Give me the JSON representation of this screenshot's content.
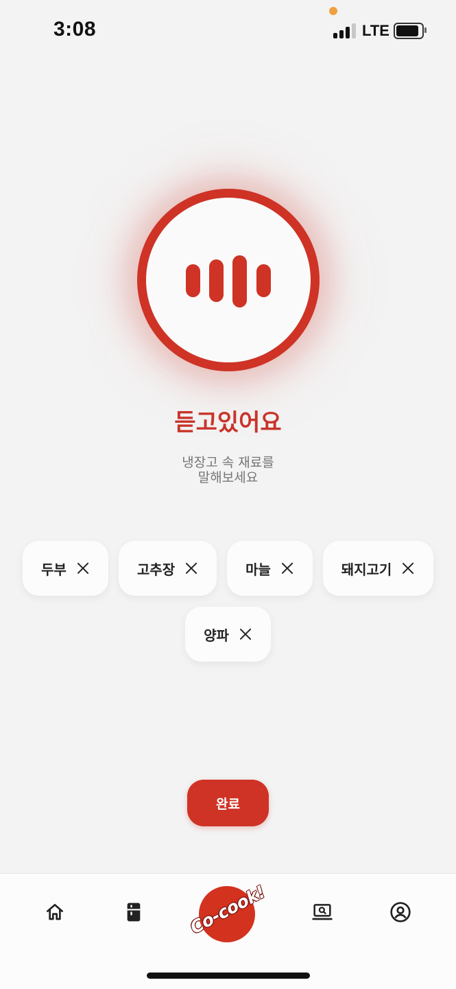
{
  "status_bar": {
    "time": "3:08",
    "network": "LTE"
  },
  "voice": {
    "title": "듣고있어요",
    "prompt_line1": "냉장고 속 재료를",
    "prompt_line2": "말해보세요"
  },
  "ingredients": [
    "두부",
    "고추장",
    "마늘",
    "돼지고기",
    "양파"
  ],
  "done_label": "완료",
  "tab_bar": {
    "logo_text": "Co-cook!",
    "tabs": [
      "home-icon",
      "fridge-icon",
      "cocook-logo",
      "recipe-search-icon",
      "profile-icon"
    ]
  },
  "colors": {
    "accent": "#ce3326",
    "background": "#f3f3f3",
    "chip": "#fcfcfc"
  }
}
